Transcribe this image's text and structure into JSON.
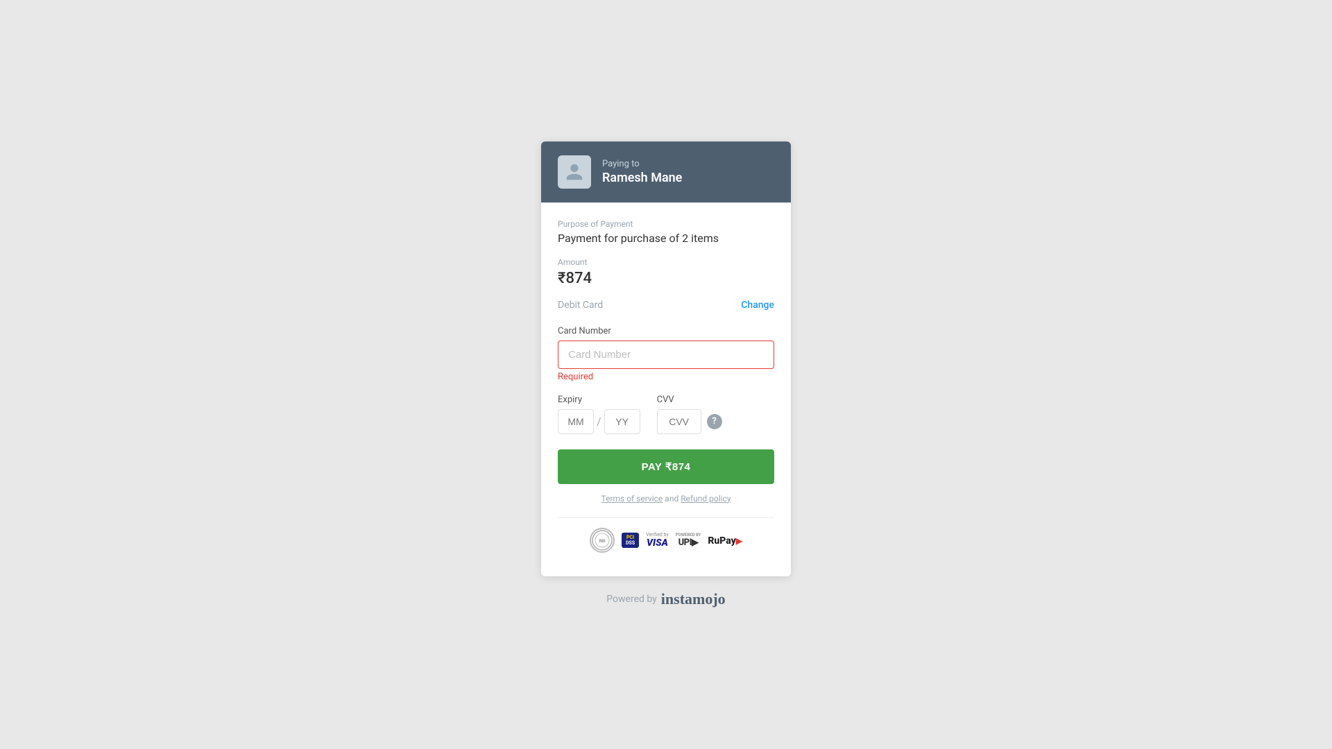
{
  "header": {
    "paying_to_label": "Paying to",
    "recipient_name": "Ramesh Mane"
  },
  "payment_info": {
    "purpose_label": "Purpose of Payment",
    "purpose_value": "Payment for purchase of 2 items",
    "amount_label": "Amount",
    "amount_value": "₹874",
    "payment_method_label": "Debit Card",
    "change_label": "Change"
  },
  "card_form": {
    "card_number_label": "Card Number",
    "card_number_placeholder": "Card Number",
    "error_text": "Required",
    "expiry_label": "Expiry",
    "expiry_mm_placeholder": "MM",
    "expiry_yy_placeholder": "YY",
    "cvv_label": "CVV",
    "cvv_placeholder": "CVV"
  },
  "pay_button_label": "PAY ₹874",
  "footer": {
    "terms_prefix": "",
    "terms_label": "Terms of service",
    "terms_and": "and",
    "refund_label": "Refund policy",
    "powered_by": "Powered by",
    "brand_name": "instamojo"
  },
  "badges": {
    "rbi_text": "RBI",
    "pci_dss": "PCI DSS",
    "verified_by": "Verified by",
    "visa": "VISA",
    "powered_by_upi": "POWERED BY",
    "upi": "UPI",
    "rupay": "RuPay"
  }
}
